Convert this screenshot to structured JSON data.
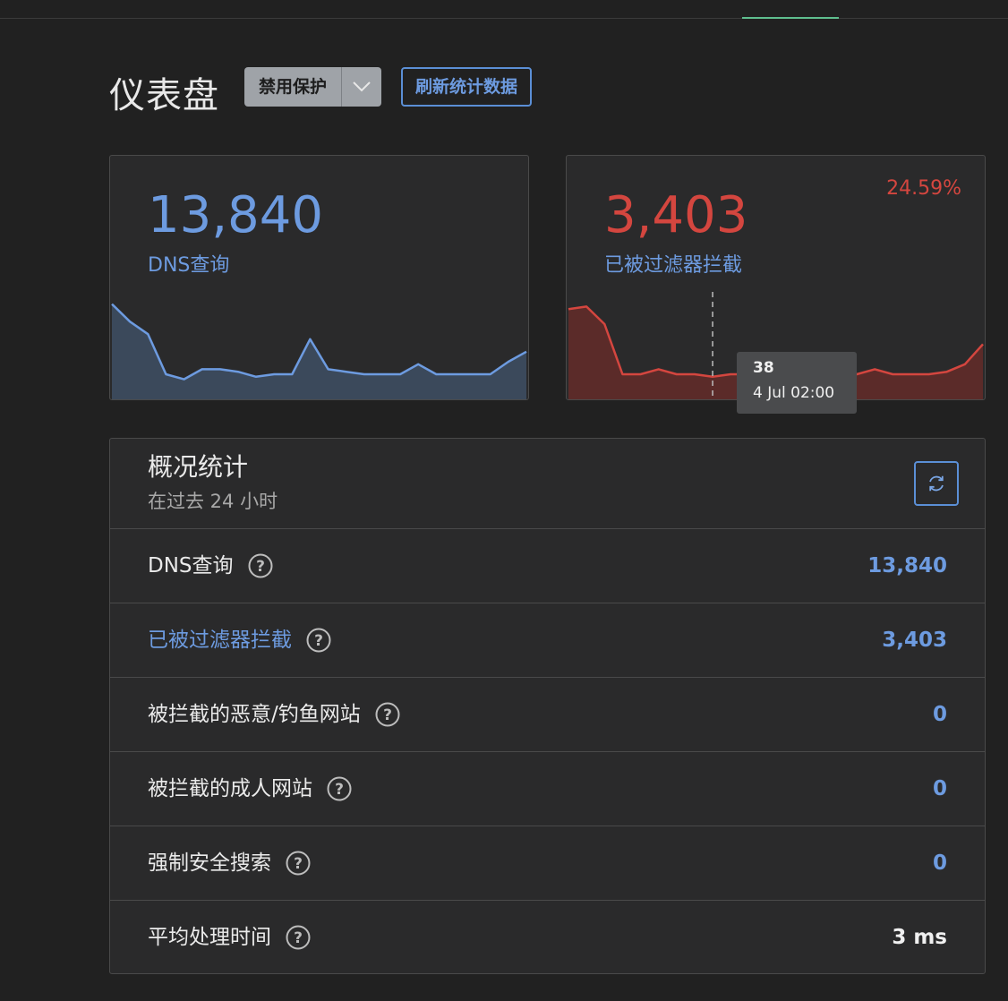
{
  "page": {
    "title": "仪表盘"
  },
  "header": {
    "disable_button": "禁用保护",
    "refresh_button": "刷新统计数据"
  },
  "cards": {
    "queries": {
      "value": "13,840",
      "label": "DNS查询",
      "color": "#6d9be0",
      "series": [
        38,
        31,
        26,
        10,
        8,
        12,
        12,
        11,
        9,
        10,
        10,
        24,
        12,
        11,
        10,
        10,
        10,
        14,
        10,
        10,
        10,
        10,
        15,
        19
      ]
    },
    "blocked": {
      "value": "3,403",
      "label": "已被过滤器拦截",
      "percent": "24.59%",
      "color": "#d4463f",
      "series": [
        36,
        37,
        30,
        10,
        10,
        12,
        10,
        10,
        9,
        10,
        10,
        10,
        10,
        10,
        10,
        10,
        10,
        12,
        10,
        10,
        10,
        11,
        14,
        22
      ],
      "tooltip": {
        "value": "38",
        "time": "4 Jul 02:00"
      }
    }
  },
  "stats": {
    "title": "概况统计",
    "subtitle": "在过去 24 小时",
    "rows": [
      {
        "label": "DNS查询",
        "value": "13,840"
      },
      {
        "label": "已被过滤器拦截",
        "value": "3,403"
      },
      {
        "label": "被拦截的恶意/钓鱼网站",
        "value": "0"
      },
      {
        "label": "被拦截的成人网站",
        "value": "0"
      },
      {
        "label": "强制安全搜索",
        "value": "0"
      },
      {
        "label": "平均处理时间",
        "value": "3 ms"
      }
    ]
  }
}
